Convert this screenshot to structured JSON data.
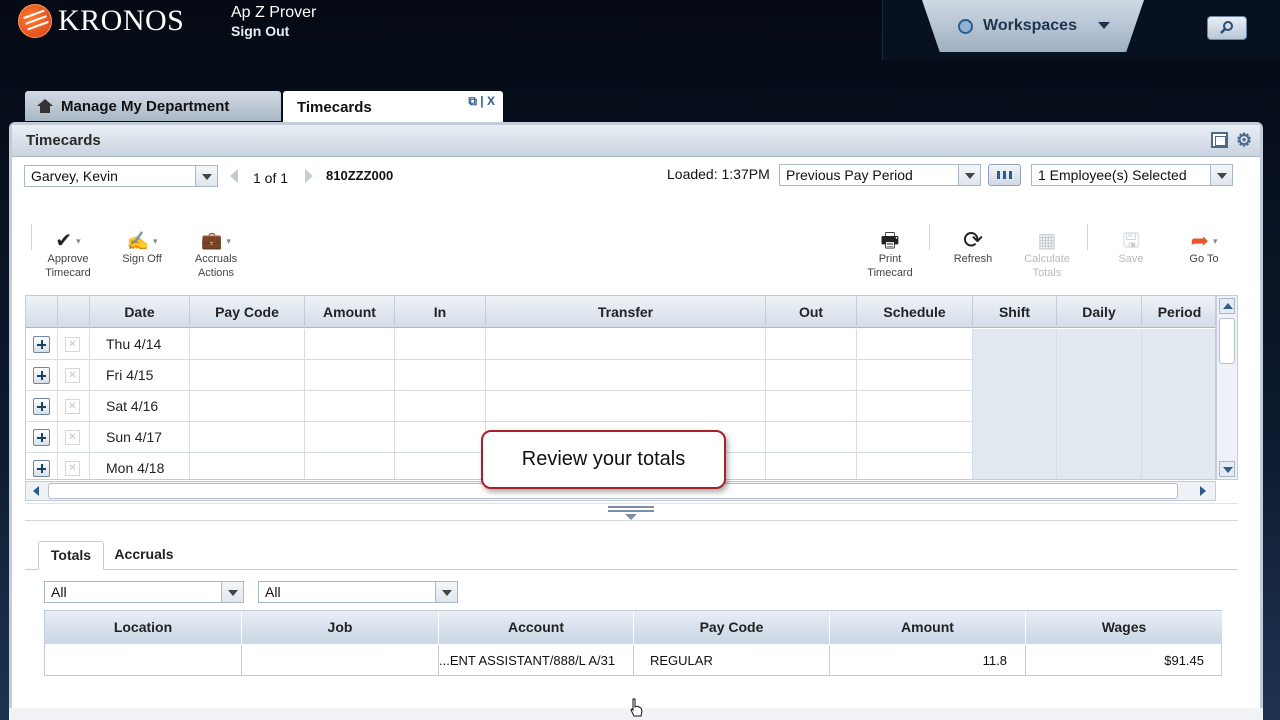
{
  "app": {
    "logo_text": "KRONOS",
    "user_name": "Ap Z Prover",
    "sign_out": "Sign Out",
    "workspaces": "Workspaces"
  },
  "tabs": {
    "manage_dept": "Manage My Department",
    "timecards": "Timecards",
    "tab_tools": "⧉ | X"
  },
  "panel": {
    "title": "Timecards"
  },
  "controls": {
    "employee": "Garvey, Kevin",
    "pager": "1 of 1",
    "employee_id": "810ZZZ000",
    "loaded": "Loaded: 1:37PM",
    "period": "Previous Pay Period",
    "selected": "1 Employee(s) Selected"
  },
  "toolbar": {
    "approve": [
      "Approve",
      "Timecard"
    ],
    "signoff": "Sign Off",
    "accruals": [
      "Accruals",
      "Actions"
    ],
    "print": [
      "Print",
      "Timecard"
    ],
    "refresh": "Refresh",
    "calculate": [
      "Calculate",
      "Totals"
    ],
    "save": "Save",
    "goto": "Go To"
  },
  "grid": {
    "columns": [
      "Date",
      "Pay Code",
      "Amount",
      "In",
      "Transfer",
      "Out",
      "Schedule",
      "Shift",
      "Daily",
      "Period"
    ],
    "rows": [
      "Thu 4/14",
      "Fri 4/15",
      "Sat 4/16",
      "Sun 4/17",
      "Mon 4/18"
    ]
  },
  "callout": "Review your totals",
  "bottom": {
    "tabs": [
      "Totals",
      "Accruals"
    ],
    "filter1": "All",
    "filter2": "All",
    "columns": [
      "Location",
      "Job",
      "Account",
      "Pay Code",
      "Amount",
      "Wages"
    ],
    "row": {
      "location": "",
      "job": "",
      "account": "...ENT ASSISTANT/888/L A/31",
      "paycode": "REGULAR",
      "amount": "11.8",
      "wages": "$91.45"
    }
  },
  "colors": {
    "accent": "#2d5b8e",
    "callout_border": "#a8202c",
    "goto_orange": "#e8562a"
  }
}
